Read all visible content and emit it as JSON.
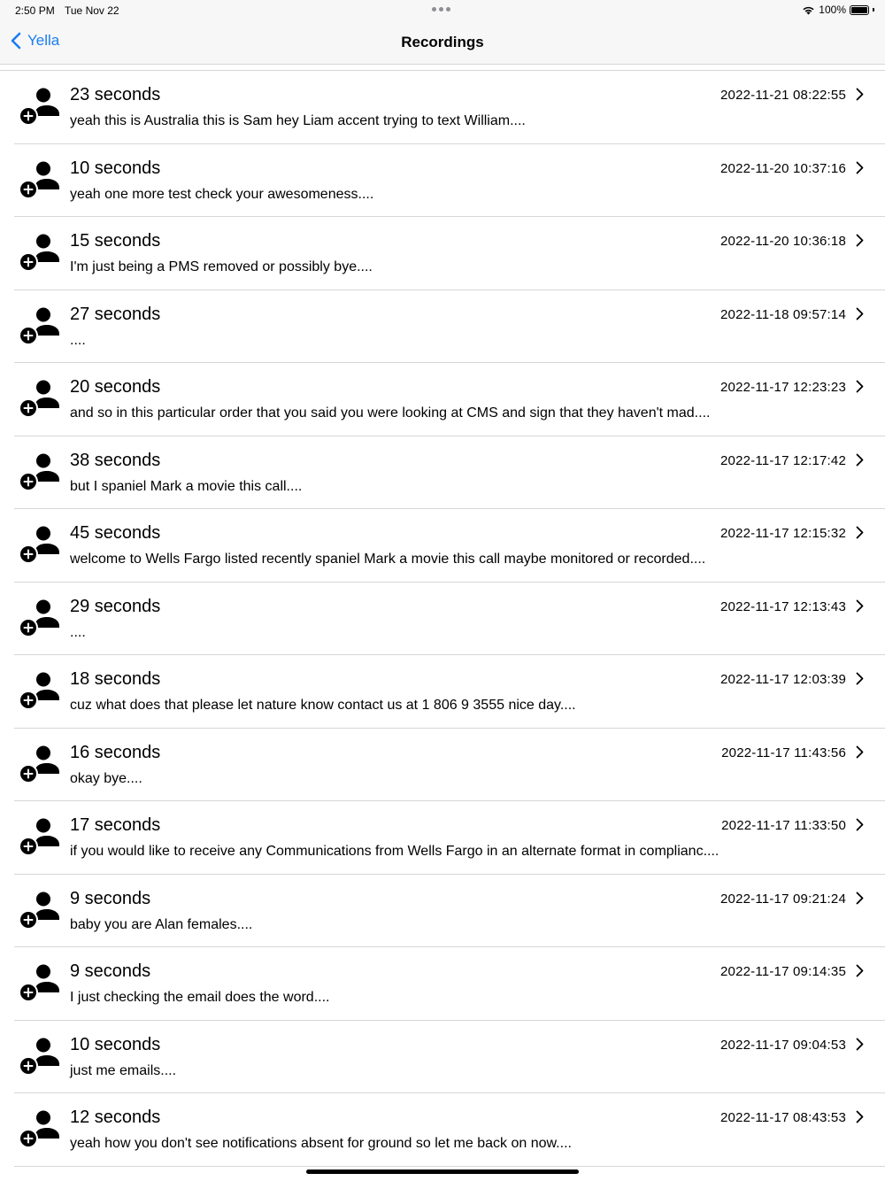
{
  "status_bar": {
    "time": "2:50 PM",
    "date": "Tue Nov 22",
    "battery": "100%",
    "battery_level": 1.0
  },
  "nav": {
    "back_label": "Yella",
    "title": "Recordings"
  },
  "colors": {
    "accent": "#1a7cf2",
    "separator": "#d6d6d9",
    "bar_background": "#f7f7f7"
  },
  "recordings": [
    {
      "duration": "23 seconds",
      "timestamp": "2022-11-21 08:22:55",
      "transcript": "yeah this is Australia this is Sam hey Liam accent trying to text William...."
    },
    {
      "duration": "10 seconds",
      "timestamp": "2022-11-20 10:37:16",
      "transcript": "yeah one more test check your awesomeness...."
    },
    {
      "duration": "15 seconds",
      "timestamp": "2022-11-20 10:36:18",
      "transcript": "I'm just being a PMS removed or possibly bye...."
    },
    {
      "duration": "27 seconds",
      "timestamp": "2022-11-18 09:57:14",
      "transcript": "...."
    },
    {
      "duration": "20 seconds",
      "timestamp": "2022-11-17 12:23:23",
      "transcript": "and so in this particular order that you said you were looking at CMS and sign that they haven't mad...."
    },
    {
      "duration": "38 seconds",
      "timestamp": "2022-11-17 12:17:42",
      "transcript": "but I spaniel Mark a movie this call...."
    },
    {
      "duration": "45 seconds",
      "timestamp": "2022-11-17 12:15:32",
      "transcript": "welcome to Wells Fargo listed recently spaniel Mark a movie this call maybe monitored or recorded...."
    },
    {
      "duration": "29 seconds",
      "timestamp": "2022-11-17 12:13:43",
      "transcript": "...."
    },
    {
      "duration": "18 seconds",
      "timestamp": "2022-11-17 12:03:39",
      "transcript": "cuz what does that please let nature know contact us at 1 806 9 3555 nice day...."
    },
    {
      "duration": "16 seconds",
      "timestamp": "2022-11-17 11:43:56",
      "transcript": "okay bye...."
    },
    {
      "duration": "17 seconds",
      "timestamp": "2022-11-17 11:33:50",
      "transcript": "if you would like to receive any Communications from Wells Fargo in an alternate format in complianc...."
    },
    {
      "duration": "9 seconds",
      "timestamp": "2022-11-17 09:21:24",
      "transcript": "baby you are Alan females...."
    },
    {
      "duration": "9 seconds",
      "timestamp": "2022-11-17 09:14:35",
      "transcript": "I just checking the email does the word...."
    },
    {
      "duration": "10 seconds",
      "timestamp": "2022-11-17 09:04:53",
      "transcript": "just me emails...."
    },
    {
      "duration": "12 seconds",
      "timestamp": "2022-11-17 08:43:53",
      "transcript": "yeah how you don't see notifications absent for ground so let me back on now...."
    }
  ]
}
